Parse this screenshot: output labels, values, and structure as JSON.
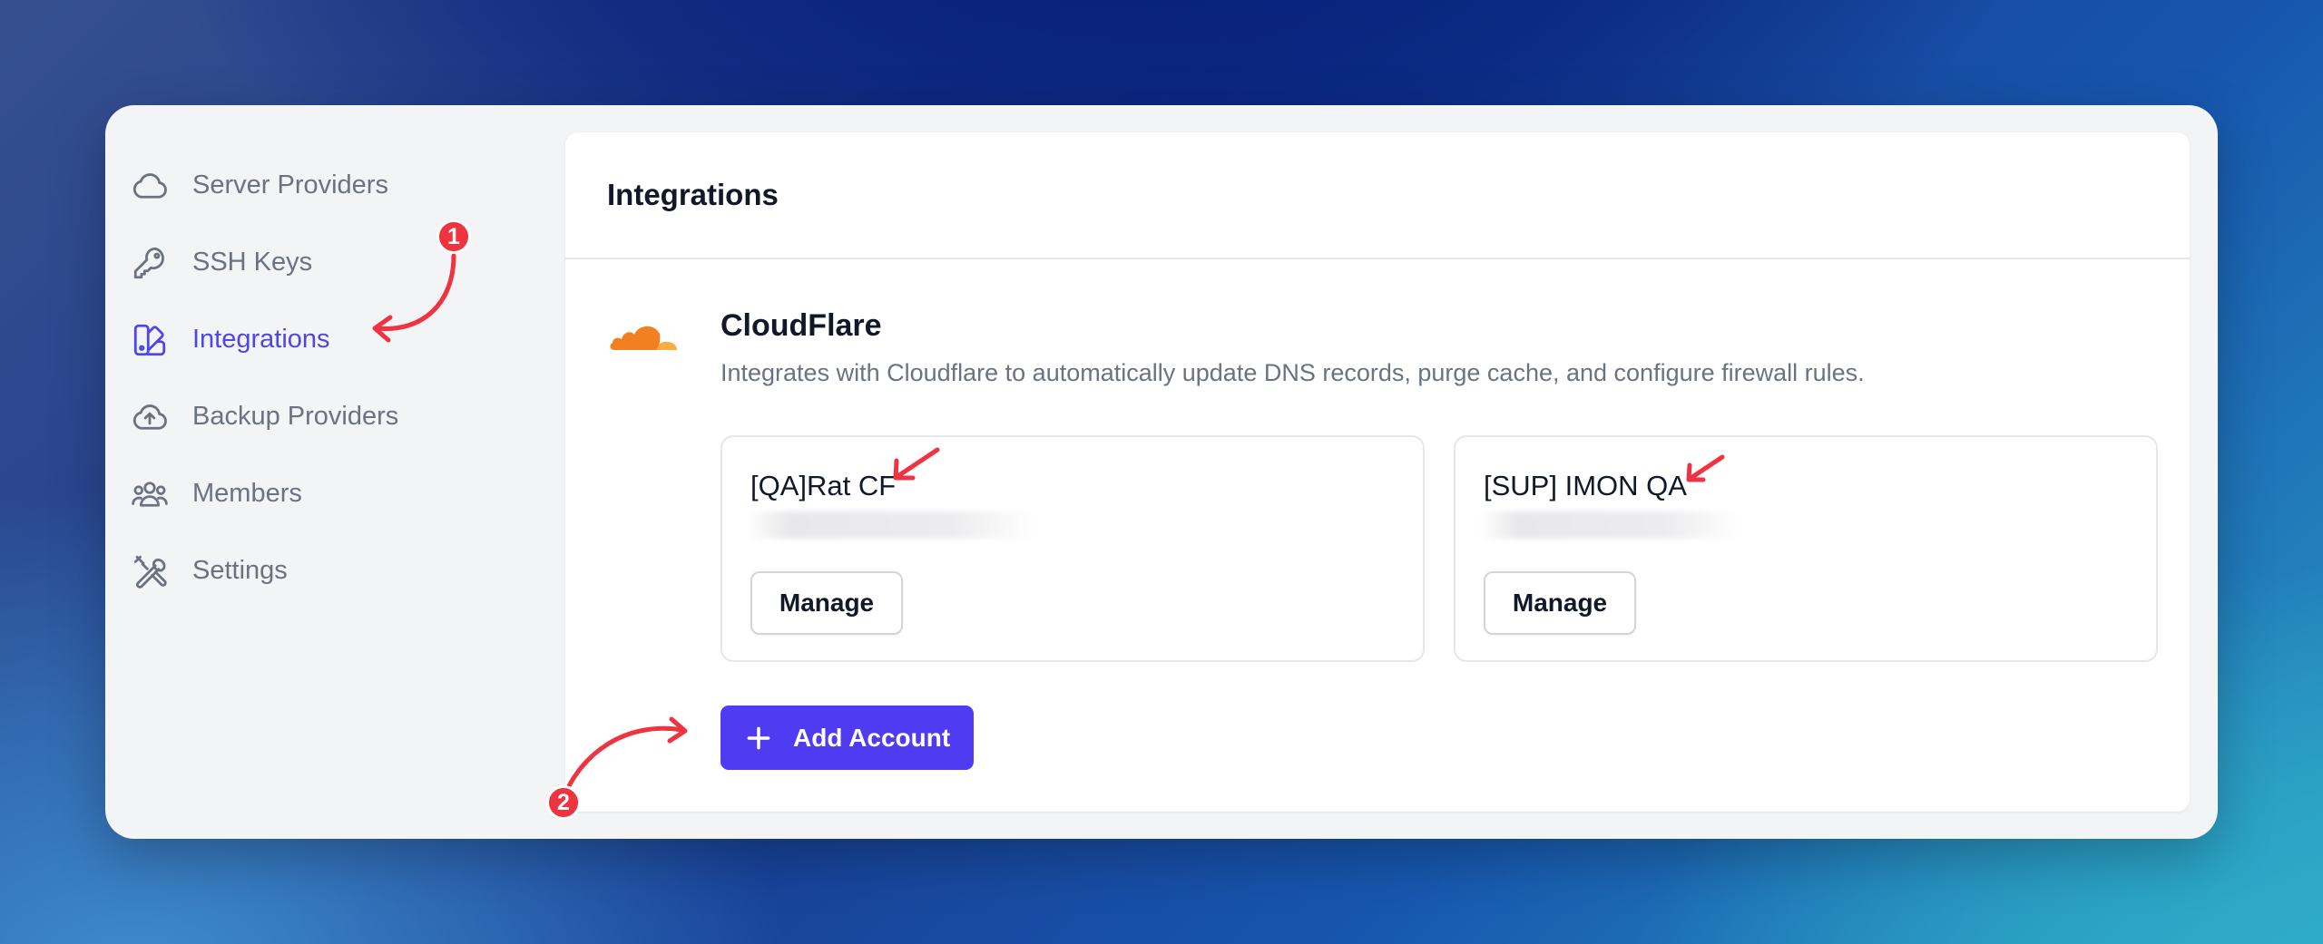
{
  "sidebar": {
    "items": [
      {
        "label": "Server Providers",
        "icon": "cloud-icon",
        "active": false
      },
      {
        "label": "SSH Keys",
        "icon": "key-icon",
        "active": false
      },
      {
        "label": "Integrations",
        "icon": "integrations-icon",
        "active": true
      },
      {
        "label": "Backup Providers",
        "icon": "cloud-upload-icon",
        "active": false
      },
      {
        "label": "Members",
        "icon": "users-icon",
        "active": false
      },
      {
        "label": "Settings",
        "icon": "tools-icon",
        "active": false
      }
    ]
  },
  "main": {
    "title": "Integrations",
    "provider": {
      "name": "CloudFlare",
      "description": "Integrates with Cloudflare to automatically update DNS records, purge cache, and configure firewall rules.",
      "logo": "cloudflare-logo",
      "accounts": [
        {
          "name": "[QA]Rat CF",
          "manage_label": "Manage"
        },
        {
          "name": "[SUP] IMON QA",
          "manage_label": "Manage"
        }
      ],
      "add_label": "Add Account"
    }
  },
  "annotations": {
    "badge1": "1",
    "badge2": "2"
  },
  "colors": {
    "accent": "#4f46e5",
    "button_primary": "#4f3cf2",
    "annotation": "#ef3340",
    "cloudflare_orange": "#f38020"
  }
}
